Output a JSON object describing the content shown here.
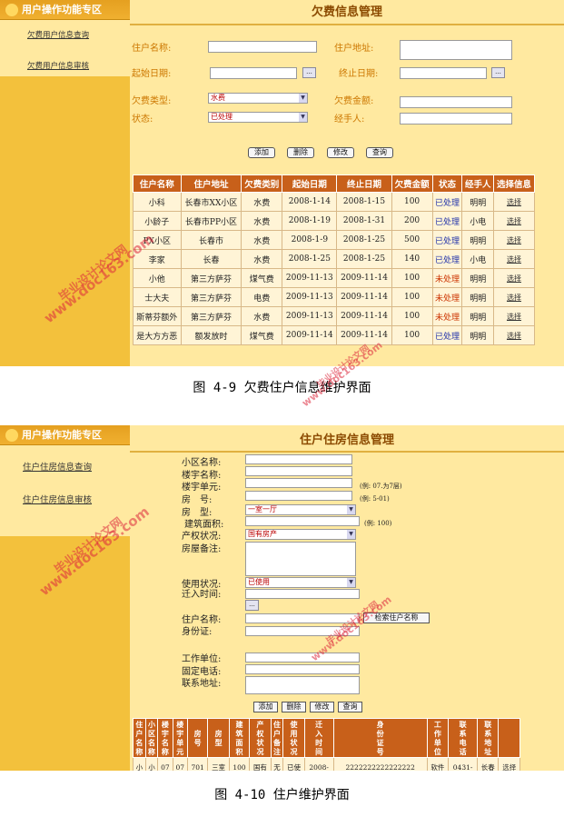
{
  "screen1": {
    "sidebar_title": "用户操作功能专区",
    "links": [
      "欠费用户信息查询",
      "欠费用户信息审核"
    ],
    "page_title": "欠费信息管理",
    "form": {
      "name": "住户名称:",
      "addr": "住户地址:",
      "start": "起始日期:",
      "end": "终止日期:",
      "type": "欠费类型:",
      "amount": "欠费金额:",
      "status": "状态:",
      "handler": "经手人:",
      "type_value": "水费",
      "status_value": "已处理",
      "date_btn": "..."
    },
    "buttons": [
      "添加",
      "删除",
      "修改",
      "查询"
    ],
    "headers": [
      "住户名称",
      "住户地址",
      "欠费类别",
      "起始日期",
      "终止日期",
      "欠费金额",
      "状态",
      "经手人",
      "选择信息"
    ],
    "rows": [
      [
        "小科",
        "长春市XX小区",
        "水费",
        "2008-1-14",
        "2008-1-15",
        "100",
        "已处理",
        "明明",
        "选择"
      ],
      [
        "小龄子",
        "长春市PP小区",
        "水费",
        "2008-1-19",
        "2008-1-31",
        "200",
        "已处理",
        "小电",
        "选择"
      ],
      [
        "PX小区",
        "长春市",
        "水费",
        "2008-1-9",
        "2008-1-25",
        "500",
        "已处理",
        "明明",
        "选择"
      ],
      [
        "李家",
        "长春",
        "水费",
        "2008-1-25",
        "2008-1-25",
        "140",
        "已处理",
        "小电",
        "选择"
      ],
      [
        "小他",
        "第三方萨芬",
        "煤气费",
        "2009-11-13",
        "2009-11-14",
        "100",
        "未处理",
        "明明",
        "选择"
      ],
      [
        "士大夫",
        "第三方萨芬",
        "电费",
        "2009-11-13",
        "2009-11-14",
        "100",
        "未处理",
        "明明",
        "选择"
      ],
      [
        "斯蒂芬额外",
        "第三方萨芬",
        "水费",
        "2009-11-13",
        "2009-11-14",
        "100",
        "未处理",
        "明明",
        "选择"
      ],
      [
        "是大方方恶",
        "额发放时",
        "煤气费",
        "2009-11-14",
        "2009-11-14",
        "100",
        "已处理",
        "明明",
        "选择"
      ]
    ]
  },
  "caption1": "图 4-9 欠费住户信息维护界面",
  "screen2": {
    "sidebar_title": "用户操作功能专区",
    "links": [
      "住户住房信息查询",
      "住户住房信息审核"
    ],
    "page_title": "住户住房信息管理",
    "labels": {
      "community": "小区名称:",
      "building": "楼宇名称:",
      "unit": "楼宇单元:",
      "room": "房　号:",
      "type": "房　型:",
      "area": "建筑面积:",
      "property": "产权状况:",
      "remark": "房屋备注:",
      "use": "使用状况:",
      "movein": "迁入时间:",
      "resident": "住户名称:",
      "idcard": "身份证:",
      "work": "工作单位:",
      "phone": "固定电话:",
      "contact": "联系地址:"
    },
    "hints": {
      "unit": "(例: 07.为7层)",
      "room": "(例: 5-01)",
      "area": "(例: 100)"
    },
    "values": {
      "type": "一室一厅",
      "property": "国有房产",
      "use": "已使用"
    },
    "search_resident_btn": "检索住户名称",
    "date_btn": "...",
    "buttons": [
      "添加",
      "删除",
      "修改",
      "查询"
    ],
    "headers": [
      "住户名称",
      "小区名称",
      "楼宇名称",
      "楼宇单元",
      "房号",
      "房型",
      "建筑面积",
      "产权状况",
      "住户备注",
      "使用状况",
      "迁入时间",
      "身份证号",
      "工作单位",
      "联系电话",
      "联系地址",
      ""
    ],
    "row": [
      "小",
      "小",
      "07",
      "07",
      "701",
      "三室",
      "100",
      "国有",
      "无",
      "已使",
      "2008-",
      "2222222222222222",
      "软件",
      "0431-",
      "长春",
      "选择"
    ]
  },
  "caption2": "图 4-10  住户维护界面",
  "watermarks": [
    "www.doc163.com",
    "毕业设计论文网",
    "www.doc163.com",
    "毕业设计论文网",
    "www.doc163.com",
    "毕业设计论文网",
    "www.doc163.com",
    "毕业设计论文网"
  ]
}
